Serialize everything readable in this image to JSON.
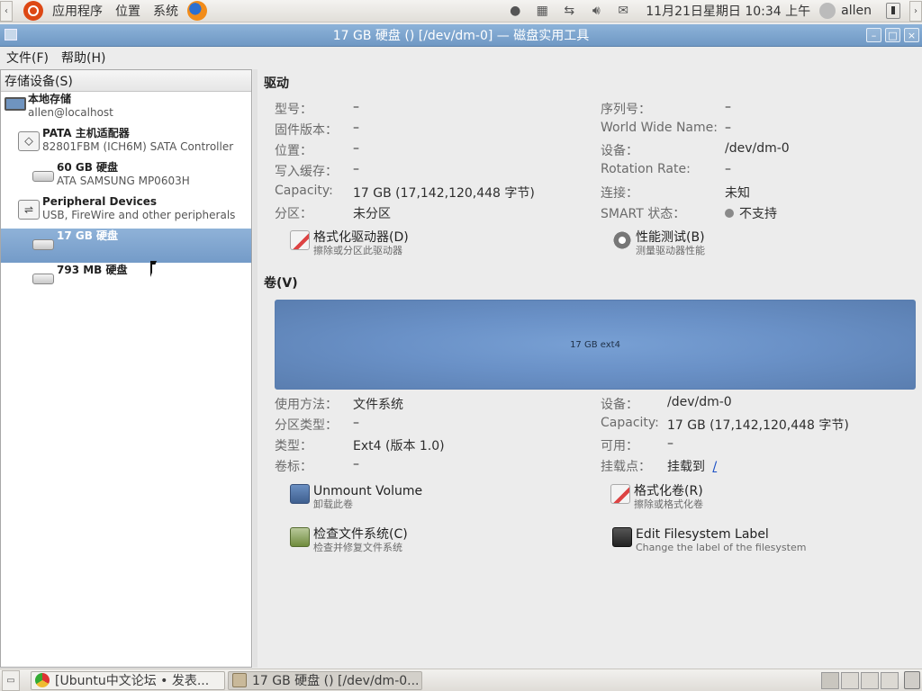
{
  "top_panel": {
    "menu": [
      "应用程序",
      "位置",
      "系统"
    ],
    "clock": "11月21日星期日 10:34 上午",
    "user": "allen"
  },
  "window": {
    "title": "17 GB 硬盘 () [/dev/dm-0] — 磁盘实用工具"
  },
  "menubar": [
    "文件(F)",
    "帮助(H)"
  ],
  "storage": {
    "header": "存储设备(S)",
    "items": [
      {
        "title": "本地存储",
        "subtitle": "allen@localhost"
      },
      {
        "title": "PATA 主机适配器",
        "subtitle": "82801FBM (ICH6M) SATA Controller"
      },
      {
        "title": "60 GB 硬盘",
        "subtitle": "ATA SAMSUNG MP0603H"
      },
      {
        "title": "Peripheral Devices",
        "subtitle": "USB, FireWire and other peripherals"
      },
      {
        "title": "17 GB 硬盘",
        "subtitle": ""
      },
      {
        "title": "793 MB 硬盘",
        "subtitle": ""
      }
    ]
  },
  "drive": {
    "title": "驱动",
    "left": [
      {
        "label": "型号：",
        "value": "–"
      },
      {
        "label": "固件版本：",
        "value": "–"
      },
      {
        "label": "位置：",
        "value": "–"
      },
      {
        "label": "写入缓存：",
        "value": "–"
      },
      {
        "label": "Capacity:",
        "value": "17 GB (17,142,120,448 字节)"
      },
      {
        "label": "分区：",
        "value": "未分区"
      }
    ],
    "right": [
      {
        "label": "序列号：",
        "value": "–"
      },
      {
        "label": "World Wide Name:",
        "value": "–"
      },
      {
        "label": "设备：",
        "value": "/dev/dm-0"
      },
      {
        "label": "Rotation Rate:",
        "value": "–"
      },
      {
        "label": "连接：",
        "value": "未知"
      },
      {
        "label": "SMART 状态：",
        "value": "不支持"
      }
    ],
    "actions": [
      {
        "title": "格式化驱动器(D)",
        "subtitle": "擦除或分区此驱动器"
      },
      {
        "title": "性能测试(B)",
        "subtitle": "测量驱动器性能"
      }
    ]
  },
  "volumes": {
    "title": "卷(V)",
    "bar_label": "17 GB ext4",
    "left": [
      {
        "label": "使用方法：",
        "value": "文件系统"
      },
      {
        "label": "分区类型：",
        "value": "–"
      },
      {
        "label": "类型：",
        "value": "Ext4 (版本 1.0)"
      },
      {
        "label": "卷标：",
        "value": "–"
      }
    ],
    "right": [
      {
        "label": "设备：",
        "value": "/dev/dm-0"
      },
      {
        "label": "Capacity:",
        "value": "17 GB (17,142,120,448 字节)"
      },
      {
        "label": "可用：",
        "value": "–"
      },
      {
        "label": "挂载点：",
        "value": "挂载到",
        "link": "/"
      }
    ],
    "actions": [
      {
        "title": "Unmount Volume",
        "subtitle": "卸载此卷"
      },
      {
        "title": "格式化卷(R)",
        "subtitle": "擦除或格式化卷"
      },
      {
        "title": "检查文件系统(C)",
        "subtitle": "检查并修复文件系统"
      },
      {
        "title": "Edit Filesystem Label",
        "subtitle": "Change the label of the filesystem"
      }
    ]
  },
  "taskbar": {
    "tasks": [
      "[Ubuntu中文论坛 • 发表...",
      "17 GB 硬盘 () [/dev/dm-0..."
    ]
  }
}
